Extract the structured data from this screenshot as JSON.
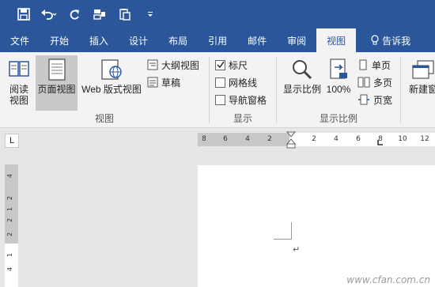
{
  "quick_access": {
    "save_icon": "save-icon",
    "undo_icon": "undo-icon",
    "redo_icon": "redo-icon",
    "extra1_icon": "layout-icon",
    "extra2_icon": "paste-icon",
    "customize_icon": "dropdown-icon"
  },
  "tabs": [
    {
      "label": "文件"
    },
    {
      "label": "开始"
    },
    {
      "label": "插入"
    },
    {
      "label": "设计"
    },
    {
      "label": "布局"
    },
    {
      "label": "引用"
    },
    {
      "label": "邮件"
    },
    {
      "label": "审阅"
    },
    {
      "label": "视图",
      "active": true
    },
    {
      "label": "告诉我"
    }
  ],
  "ribbon": {
    "views": {
      "label": "视图",
      "read_mode": "阅读\n视图",
      "read_mode_line1": "阅读",
      "read_mode_line2": "视图",
      "print_layout": "页面视图",
      "web_layout": "Web 版式视图",
      "outline": "大纲视图",
      "draft": "草稿"
    },
    "show": {
      "label": "显示",
      "ruler": "标尺",
      "ruler_checked": true,
      "gridlines": "网格线",
      "gridlines_checked": false,
      "nav_pane": "导航窗格",
      "nav_pane_checked": false
    },
    "zoom": {
      "label": "显示比例",
      "zoom": "显示比例",
      "hundred": "100%",
      "one_page": "单页",
      "multi_page": "多页",
      "page_width": "页宽"
    },
    "window": {
      "new_window": "新建窗"
    }
  },
  "ruler": {
    "tab_selector": "L",
    "h_ticks": [
      "8",
      "6",
      "4",
      "2",
      "2",
      "4",
      "6",
      "8",
      "10",
      "12"
    ],
    "v_ticks": [
      "4",
      "2",
      "2",
      "4",
      "1",
      "2",
      "1"
    ]
  },
  "document": {
    "paragraph_mark": "↵"
  },
  "watermark": "www.cfan.com.cn"
}
